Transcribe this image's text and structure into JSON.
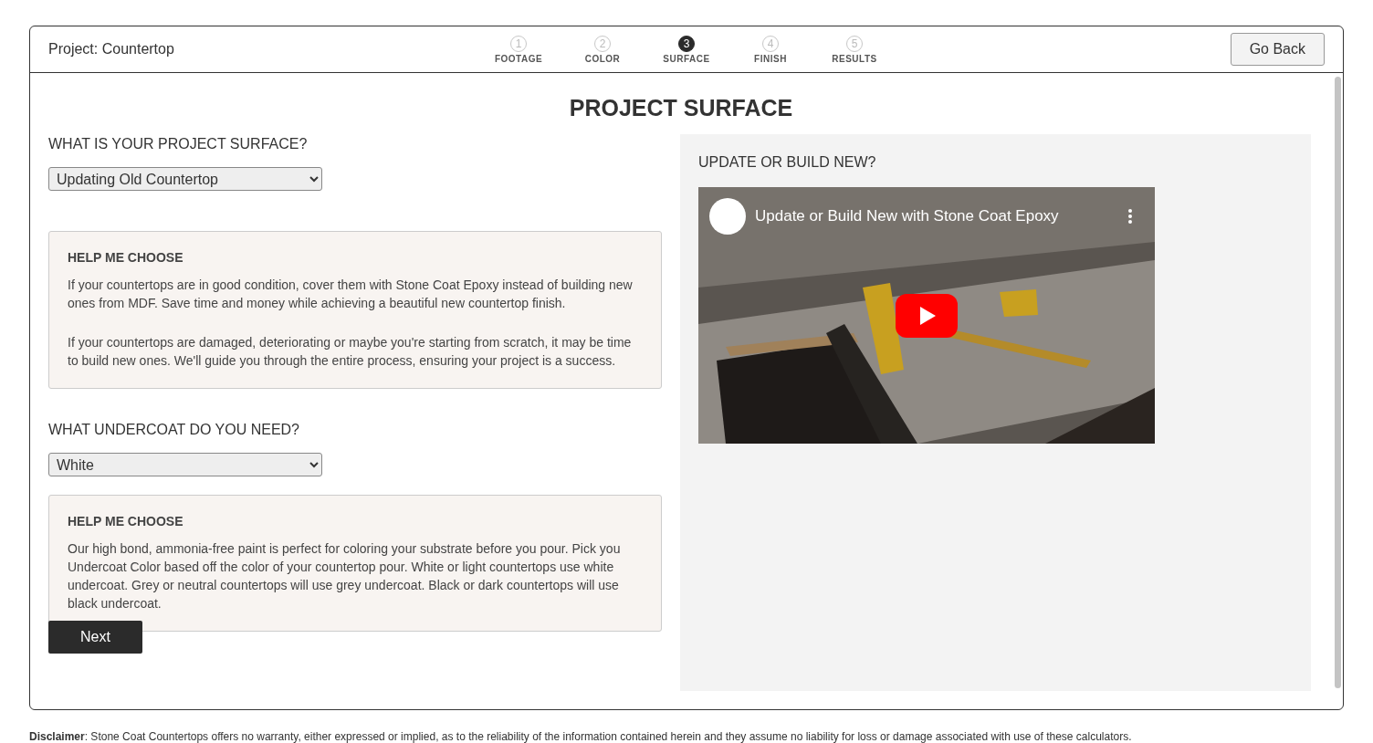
{
  "header": {
    "project": "Project: Countertop",
    "back_button": "Go Back"
  },
  "steps": [
    {
      "number": "1",
      "label": "FOOTAGE",
      "selected": false
    },
    {
      "number": "2",
      "label": "COLOR",
      "selected": false
    },
    {
      "number": "3",
      "label": "SURFACE",
      "selected": true
    },
    {
      "number": "4",
      "label": "FINISH",
      "selected": false
    },
    {
      "number": "5",
      "label": "RESULTS",
      "selected": false
    }
  ],
  "page_title": "PROJECT SURFACE",
  "sections": [
    {
      "question": "WHAT IS YOUR PROJECT SURFACE?",
      "value": "Updating Old Countertop",
      "help_title": "HELP ME CHOOSE",
      "help_paragraphs": [
        "If your countertops are in good condition, cover them with Stone Coat Epoxy instead of building new ones from MDF. Save time and money while achieving a beautiful new countertop finish.",
        "If your countertops are damaged, deteriorating or maybe you're starting from scratch, it may be time to build new ones. We'll guide you through the entire process, ensuring your project is a success."
      ]
    },
    {
      "question": "WHAT UNDERCOAT DO YOU NEED?",
      "value": "White",
      "help_title": "HELP ME CHOOSE",
      "help_paragraphs": [
        "Our high bond, ammonia-free paint is perfect for coloring your substrate before you pour. Pick you Undercoat Color based off the color of your countertop pour. White or light countertops use white undercoat. Grey or neutral countertops will use grey undercoat. Black or dark countertops will use black undercoat."
      ]
    }
  ],
  "next_button": "Next",
  "video_panel": {
    "heading": "UPDATE OR BUILD NEW?",
    "video_title": "Update or Build New with Stone Coat Epoxy",
    "kind": "picture"
  },
  "disclaimer": "**Disclaimer**: Stone Coat Countertops offers no warranty, either expressed or implied, as to the reliability of the information contained herein and they assume no liability for loss or damage associated with use of these calculators."
}
